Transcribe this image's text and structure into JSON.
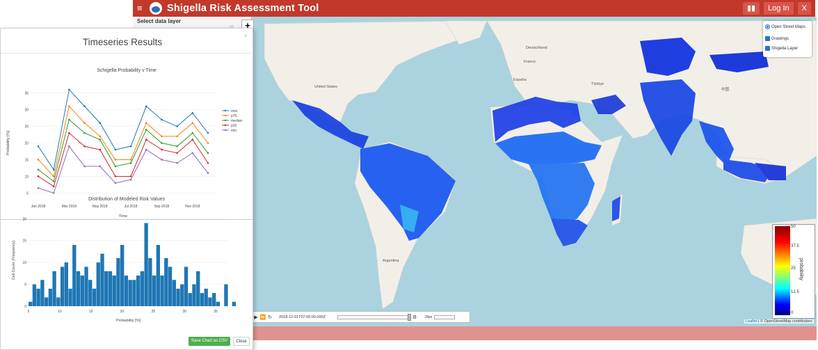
{
  "app": {
    "title": "Shigella Risk Assessment Tool",
    "login_label": "Log In",
    "close_label": "X",
    "menu_icon": "hamburger-icon",
    "chart_icon": "bar-chart-icon",
    "brand_color": "#c1392b"
  },
  "sidebar": {
    "select_layer_label": "Select data layer"
  },
  "map": {
    "zoom_in_label": "+",
    "labels": {
      "united_states": "United States",
      "deutschland": "Deutschland",
      "france": "France",
      "espana": "España",
      "turkiye": "Türkiye",
      "china": "中国",
      "argentina": "Argentina"
    },
    "layers": [
      {
        "label": "Open Street Maps",
        "type": "radio",
        "checked": true
      },
      {
        "label": "Drawings",
        "type": "checkbox",
        "checked": true
      },
      {
        "label": "Shigella Layer",
        "type": "checkbox",
        "checked": true
      }
    ],
    "legend": {
      "title": "probability",
      "ticks": [
        "50",
        "37.5",
        "25",
        "12.5",
        "0"
      ]
    },
    "time_control": {
      "timestamp": "2018-12-01T07:00:00.000Z",
      "fps": "2fps"
    },
    "attribution": {
      "leaflet": "Leaflet",
      "osm": " | © OpenStreetMap contributors"
    }
  },
  "modal": {
    "title": "Timeseries Results",
    "close_icon": "×",
    "save_label": "Save Chart as CSV",
    "close_label": "Close"
  },
  "chart_data": [
    {
      "type": "line",
      "title": "Schigella Probability v Time",
      "xlabel": "Time",
      "ylabel": "Probability [%]",
      "x": [
        "2018-01",
        "2018-02",
        "2018-03",
        "2018-04",
        "2018-05",
        "2018-06",
        "2018-07",
        "2018-08",
        "2018-09",
        "2018-10",
        "2018-11",
        "2018-12"
      ],
      "x_ticks": [
        "Jan 2018",
        "Mar 2018",
        "May 2018",
        "Jul 2018",
        "Sep 2018",
        "Nov 2018"
      ],
      "y_ticks": [
        5,
        10,
        15,
        20,
        25,
        30,
        35
      ],
      "ylim": [
        3,
        37
      ],
      "legend_position": "right",
      "series": [
        {
          "name": "max",
          "color": "#1f77b4",
          "values": [
            19,
            12,
            36,
            31,
            26,
            18,
            19,
            31,
            27,
            25,
            29,
            23
          ]
        },
        {
          "name": "p75",
          "color": "#ff7f0e",
          "values": [
            15,
            10,
            31,
            26,
            22,
            15,
            15,
            26,
            22,
            22,
            26,
            20
          ]
        },
        {
          "name": "median",
          "color": "#2ca02c",
          "values": [
            12,
            8.5,
            27,
            23,
            21,
            13,
            14,
            24,
            20,
            19,
            23,
            17
          ]
        },
        {
          "name": "p25",
          "color": "#d62728",
          "values": [
            10,
            7,
            23,
            19,
            18,
            10,
            10,
            21,
            18,
            17,
            21,
            14
          ]
        },
        {
          "name": "min",
          "color": "#9467bd",
          "values": [
            6.5,
            5,
            19,
            13,
            13,
            8,
            9,
            18,
            15,
            14,
            17,
            11
          ]
        }
      ]
    },
    {
      "type": "bar",
      "title": "Distribution of Modeled Risk Values",
      "xlabel": "Probability [%]",
      "ylabel": "Cell Count (Frequency)",
      "color": "#1f77b4",
      "xlim": [
        5,
        37
      ],
      "ylim": [
        0,
        21
      ],
      "x_ticks": [
        5,
        10,
        15,
        20,
        25,
        30,
        35
      ],
      "y_ticks": [
        0,
        5,
        10,
        15,
        20
      ],
      "bin_width": 0.64,
      "bin_start": 5,
      "values": [
        1,
        5,
        4,
        6,
        2,
        4,
        8,
        2,
        9,
        10,
        4,
        14,
        8,
        7,
        9,
        6,
        4,
        10,
        12,
        8,
        8,
        7,
        11,
        14,
        7,
        6,
        6,
        7,
        8,
        19,
        11,
        7,
        14,
        7,
        11,
        9,
        6,
        4,
        5,
        9,
        3,
        5,
        8,
        3,
        4,
        2,
        3,
        1,
        0,
        5,
        0,
        1,
        0,
        0,
        0,
        0,
        0,
        0,
        0,
        0,
        0,
        1
      ]
    }
  ]
}
